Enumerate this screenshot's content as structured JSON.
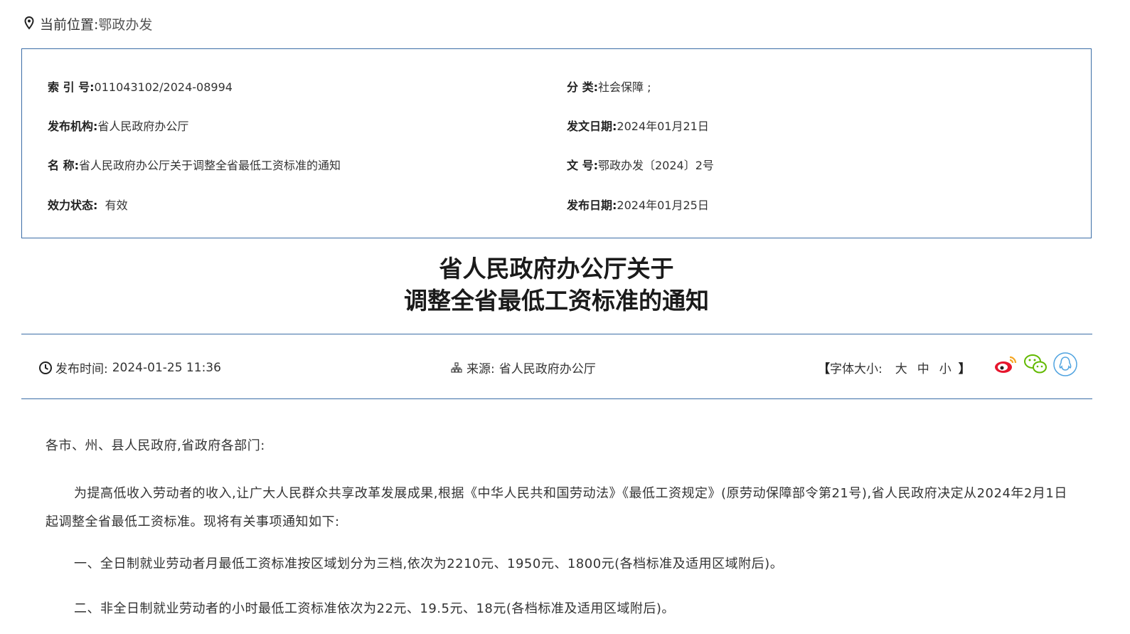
{
  "breadcrumb": {
    "label": "当前位置:",
    "current": "鄂政办发"
  },
  "meta": {
    "index_key": "索  引  号:",
    "index_value": "011043102/2024-08994",
    "category_key": "分  类:",
    "category_value": "社会保障  ;",
    "issuer_key": "发布机构:",
    "issuer_value": "省人民政府办公厅",
    "doc_date_key": "发文日期:",
    "doc_date_value": "2024年01月21日",
    "name_key": "名  称:",
    "name_value": "省人民政府办公厅关于调整全省最低工资标准的通知",
    "doc_no_key": "文  号:",
    "doc_no_value": "鄂政办发〔2024〕2号",
    "status_key": "效力状态:",
    "status_value": "有效",
    "pub_date_key": "发布日期:",
    "pub_date_value": "2024年01月25日"
  },
  "title": {
    "line1": "省人民政府办公厅关于",
    "line2": "调整全省最低工资标准的通知"
  },
  "info": {
    "pubtime_label": "发布时间:",
    "pubtime_value": "2024-01-25 11:36",
    "source_label": "来源:",
    "source_value": "省人民政府办公厅",
    "fontsize_open": "【",
    "fontsize_label": "字体大小:",
    "font_large": "大",
    "font_medium": "中",
    "font_small": "小",
    "fontsize_close": "】",
    "share_icons": [
      "weibo-icon",
      "wechat-icon",
      "qq-icon"
    ]
  },
  "content": {
    "salutation": "各市、州、县人民政府,省政府各部门:",
    "intro": "为提高低收入劳动者的收入,让广大人民群众共享改革发展成果,根据《中华人民共和国劳动法》《最低工资规定》(原劳动保障部令第21号),省人民政府决定从2024年2月1日起调整全省最低工资标准。现将有关事项通知如下:",
    "item_one": "一、全日制就业劳动者月最低工资标准按区域划分为三档,依次为2210元、1950元、1800元(各档标准及适用区域附后)。",
    "item_two": "二、非全日制就业劳动者的小时最低工资标准依次为22元、19.5元、18元(各档标准及适用区域附后)。"
  },
  "colors": {
    "border": "#3b6da7",
    "weibo": "#e6162d",
    "wechat": "#62b900",
    "qq": "#4fa3e0"
  }
}
